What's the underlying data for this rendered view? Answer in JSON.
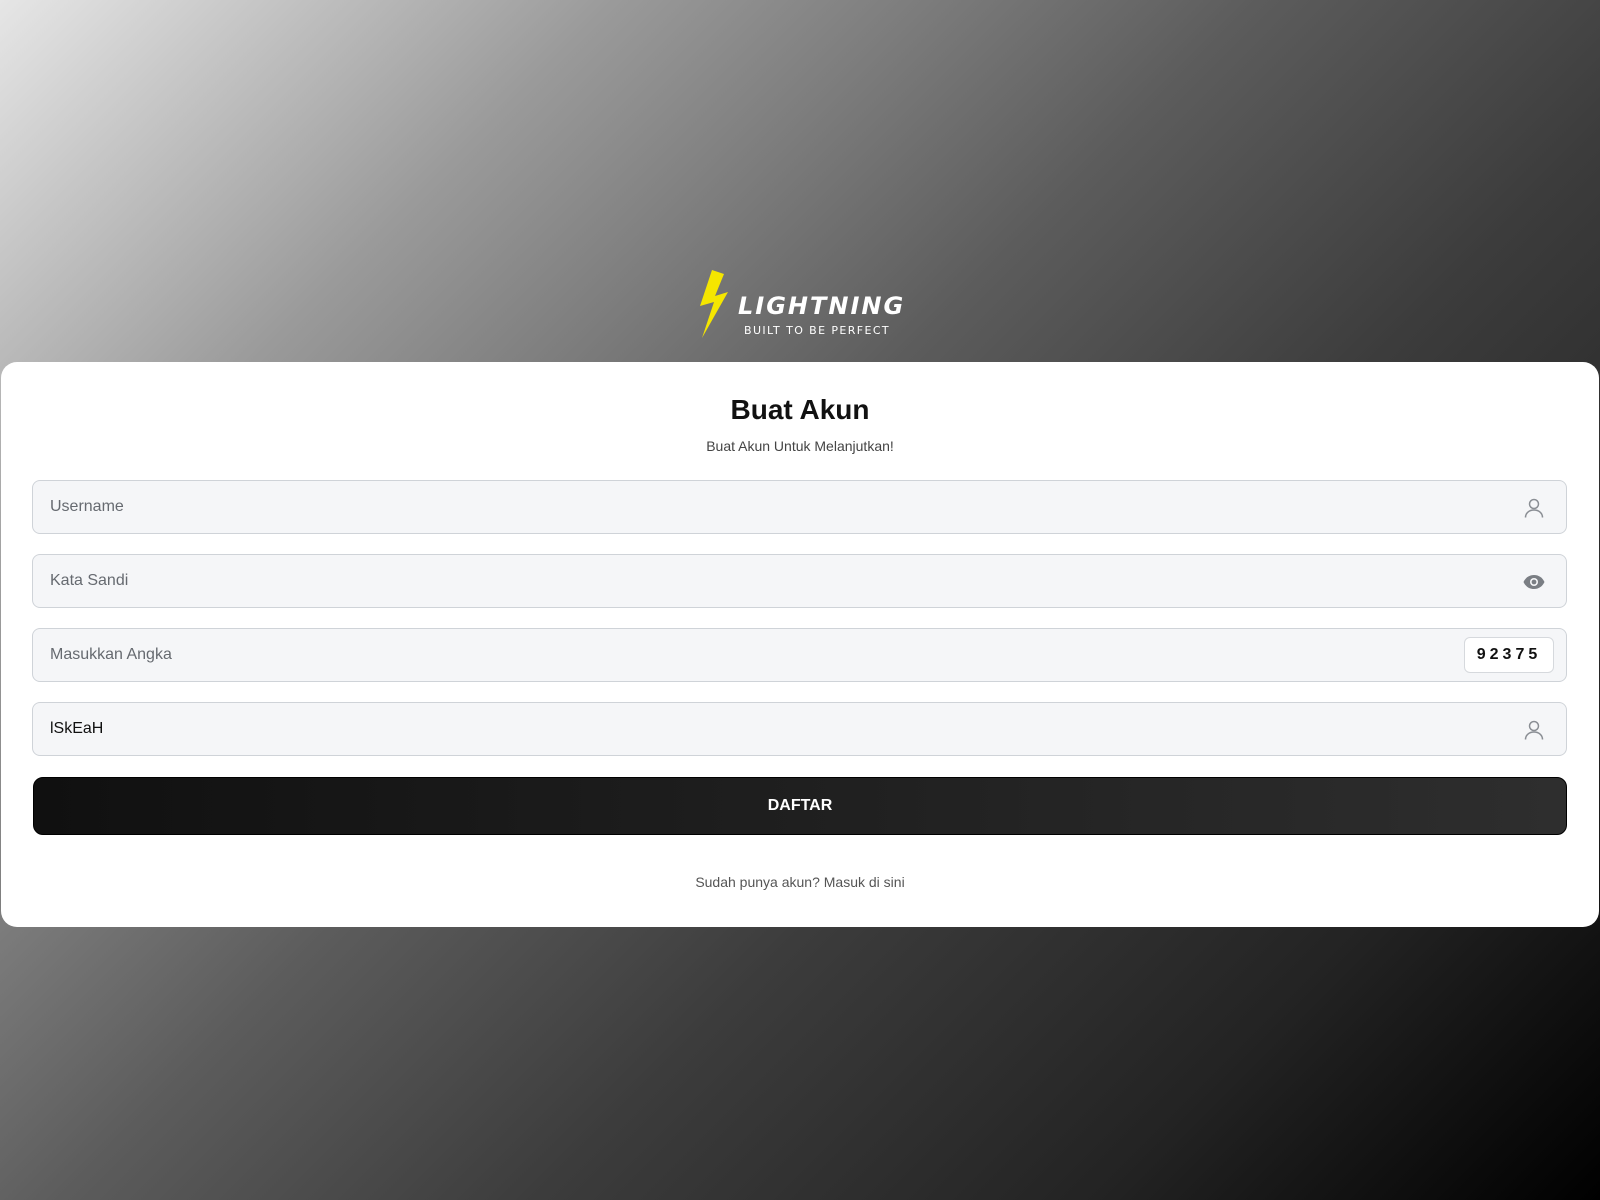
{
  "brand": {
    "name": "LIGHTNING",
    "tagline": "BUILT TO BE PERFECT",
    "bolt_color": "#f5e600"
  },
  "form": {
    "title": "Buat Akun",
    "subtitle": "Buat Akun Untuk Melanjutkan!",
    "username": {
      "placeholder": "Username",
      "value": "",
      "icon": "user-icon"
    },
    "password": {
      "placeholder": "Kata Sandi",
      "value": "",
      "icon": "eye-icon"
    },
    "captcha": {
      "placeholder": "Masukkan Angka",
      "value": "",
      "code": "92375"
    },
    "extra_field": {
      "value": "lSkEaH",
      "icon": "user-icon"
    },
    "submit_label": "DAFTAR",
    "login_prompt": "Sudah punya akun?",
    "login_link": "Masuk di sini"
  }
}
